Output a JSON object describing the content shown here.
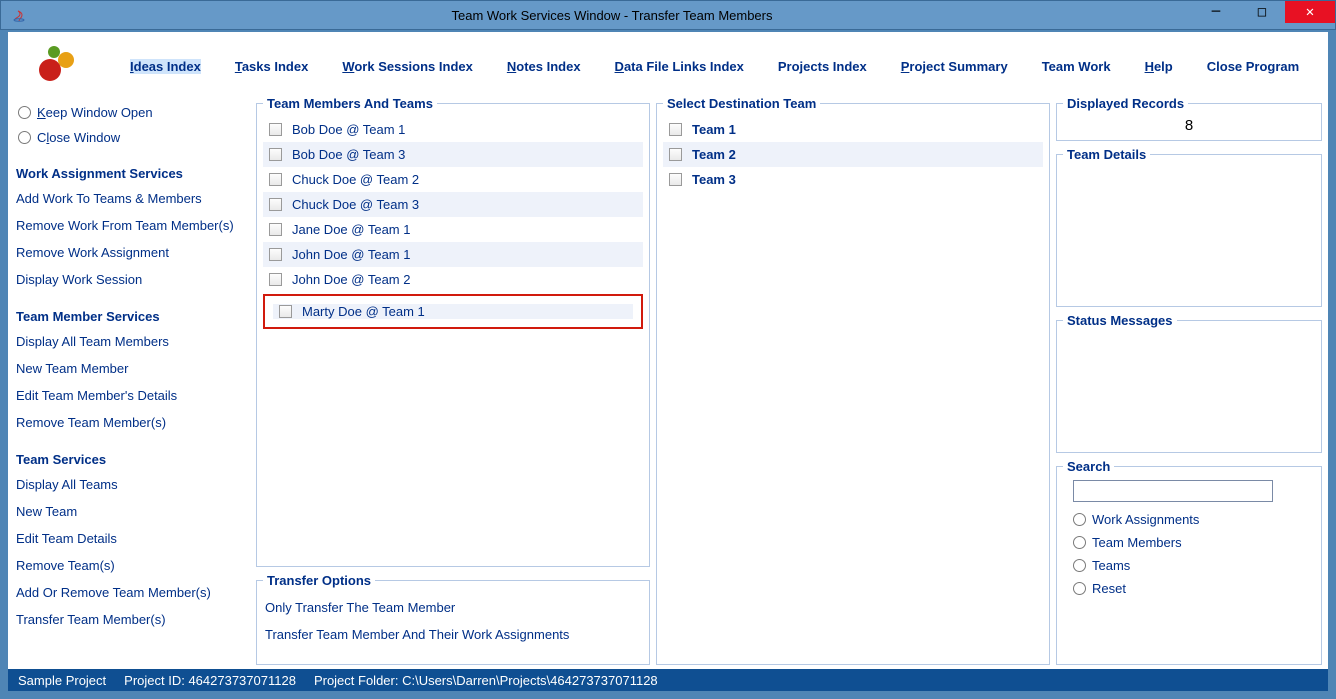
{
  "window": {
    "title": "Team Work Services Window - Transfer Team Members"
  },
  "menu": {
    "ideas": "Ideas Index",
    "tasks": "Tasks Index",
    "work_sessions": "Work Sessions Index",
    "notes": "Notes Index",
    "data_file_links": "Data File Links Index",
    "projects": "Projects Index",
    "project_summary": "Project Summary",
    "team_work": "Team Work",
    "help": "Help",
    "close_program": "Close Program"
  },
  "sidebar": {
    "keep_open": "Keep Window Open",
    "close_window": "Close Window",
    "headings": {
      "work_assignment": "Work Assignment Services",
      "team_member": "Team Member Services",
      "team_services": "Team Services"
    },
    "links": {
      "add_work": "Add Work To Teams & Members",
      "remove_work_member": "Remove Work From Team Member(s)",
      "remove_assignment": "Remove Work Assignment",
      "display_session": "Display Work Session",
      "display_all_members": "Display All Team Members",
      "new_member": "New Team Member",
      "edit_member": "Edit Team Member's Details",
      "remove_member": "Remove Team Member(s)",
      "display_all_teams": "Display All Teams",
      "new_team": "New Team",
      "edit_team": "Edit Team Details",
      "remove_team": "Remove Team(s)",
      "add_remove_members": "Add Or Remove Team Member(s)",
      "transfer_members": "Transfer Team Member(s)"
    }
  },
  "panels": {
    "members_title": "Team Members And Teams",
    "destination_title": "Select Destination Team",
    "transfer_title": "Transfer Options",
    "records_title": "Displayed Records",
    "team_details_title": "Team Details",
    "status_title": "Status Messages",
    "search_title": "Search"
  },
  "members": [
    "Bob Doe @ Team 1",
    "Bob Doe @ Team 3",
    "Chuck Doe @ Team 2",
    "Chuck Doe @ Team 3",
    "Jane Doe @ Team 1",
    "John Doe @ Team 1",
    "John Doe @ Team 2",
    "Marty Doe @ Team 1"
  ],
  "destinations": [
    "Team 1",
    "Team 2",
    "Team 3"
  ],
  "transfer_options": {
    "only_member": "Only Transfer The Team Member",
    "member_and_work": "Transfer Team Member And Their Work Assignments"
  },
  "records_count": "8",
  "search_options": {
    "work_assignments": "Work Assignments",
    "team_members": "Team Members",
    "teams": "Teams",
    "reset": "Reset"
  },
  "status_bar": {
    "project_name": "Sample Project",
    "project_id": "Project ID:  464273737071128",
    "project_folder": "Project Folder: C:\\Users\\Darren\\Projects\\464273737071128"
  }
}
